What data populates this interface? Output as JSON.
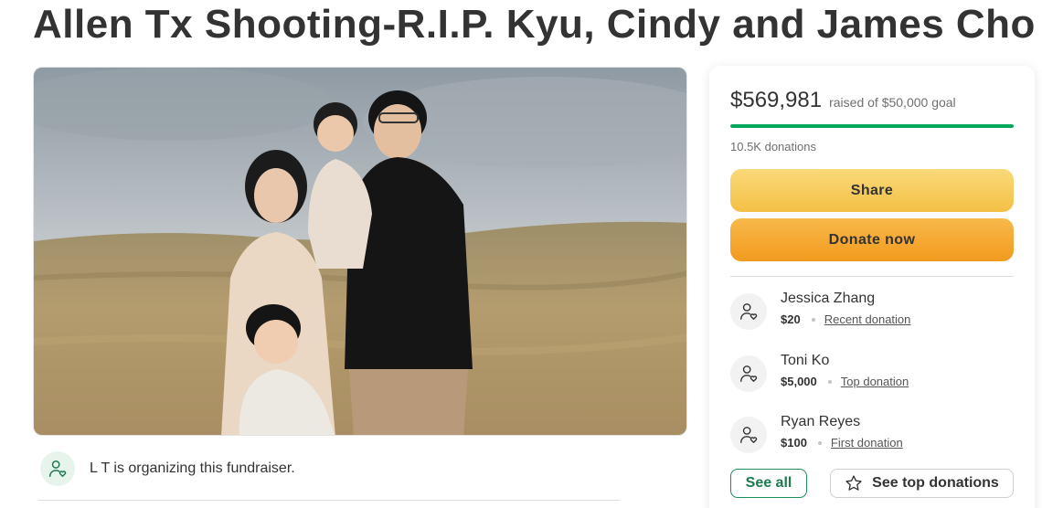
{
  "page": {
    "title": "Allen Tx Shooting-R.I.P. Kyu, Cindy and James Cho"
  },
  "organizer": {
    "text": "L T is organizing this fundraiser.",
    "icon": "person-heart-icon"
  },
  "donation_card": {
    "amount_raised": "$569,981",
    "goal_text": "raised of $50,000 goal",
    "progress_fraction": 1.0,
    "donations_count": "10.5K donations",
    "share_label": "Share",
    "donate_label": "Donate now",
    "donors": [
      {
        "name": "Jessica Zhang",
        "amount": "$20",
        "type": "Recent donation"
      },
      {
        "name": "Toni Ko",
        "amount": "$5,000",
        "type": "Top donation"
      },
      {
        "name": "Ryan Reyes",
        "amount": "$100",
        "type": "First donation"
      }
    ],
    "see_all_label": "See all",
    "see_top_label": "See top donations"
  },
  "colors": {
    "progress": "#02a95c",
    "share_button": "#f4c044",
    "donate_button": "#f29a1e",
    "see_all_text": "#1d7a4e"
  }
}
